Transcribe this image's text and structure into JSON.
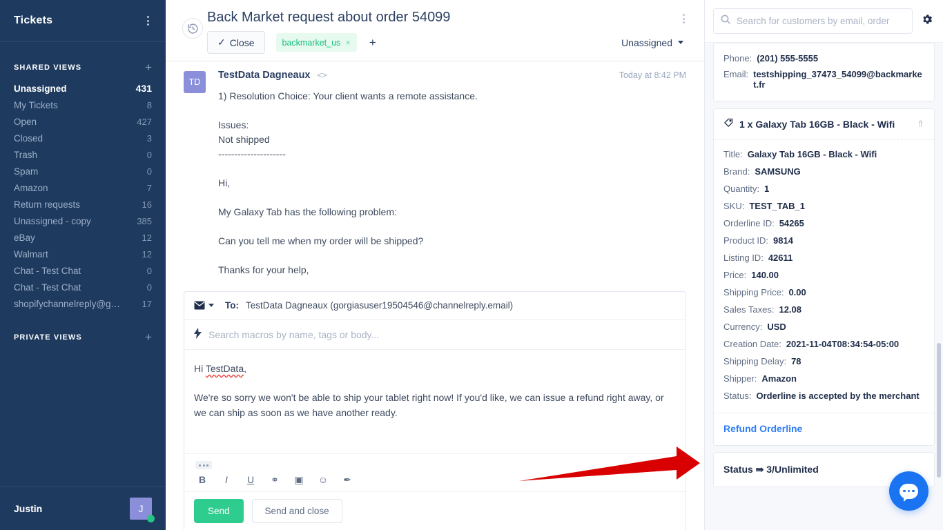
{
  "sidebar": {
    "title": "Tickets",
    "menu_icon": "kebab-menu-icon",
    "shared_views_label": "SHARED VIEWS",
    "private_views_label": "PRIVATE VIEWS",
    "add_label": "+",
    "views": [
      {
        "label": "Unassigned",
        "count": "431",
        "active": true
      },
      {
        "label": "My Tickets",
        "count": "8",
        "active": false
      },
      {
        "label": "Open",
        "count": "427",
        "active": false
      },
      {
        "label": "Closed",
        "count": "3",
        "active": false
      },
      {
        "label": "Trash",
        "count": "0",
        "active": false
      },
      {
        "label": "Spam",
        "count": "0",
        "active": false
      },
      {
        "label": "Amazon",
        "count": "7",
        "active": false
      },
      {
        "label": "Return requests",
        "count": "16",
        "active": false
      },
      {
        "label": "Unassigned - copy",
        "count": "385",
        "active": false
      },
      {
        "label": "eBay",
        "count": "12",
        "active": false
      },
      {
        "label": "Walmart",
        "count": "12",
        "active": false
      },
      {
        "label": "Chat - Test Chat",
        "count": "0",
        "active": false
      },
      {
        "label": "Chat - Test Chat",
        "count": "0",
        "active": false
      },
      {
        "label": "shopifychannelreply@gm...",
        "count": "17",
        "active": false
      }
    ],
    "user_name": "Justin",
    "user_initial": "J"
  },
  "ticket": {
    "title": "Back Market request about order 54099",
    "history_icon": "history-icon",
    "kebab_icon": "kebab-menu-icon",
    "close_label": "Close",
    "close_check": "✓",
    "tag": "backmarket_us",
    "tag_remove": "×",
    "add_tag": "+",
    "assignee": "Unassigned"
  },
  "message": {
    "avatar_initials": "TD",
    "author": "TestData Dagneaux",
    "code_icon": "<>",
    "timestamp": "Today at 8:42 PM",
    "body": "1) Resolution Choice: Your client wants a remote assistance.\n\nIssues:\nNot shipped\n---------------------\n\nHi,\n\nMy Galaxy Tab has the following problem:\n\nCan you tell me when my order will be shipped?\n\nThanks for your help,"
  },
  "composer": {
    "channel_icon": "envelope-icon",
    "to_label": "To:",
    "to_value": "TestData Dagneaux (gorgiasuser19504546@channelreply.email)",
    "macro_icon": "lightning-bolt-icon",
    "macro_placeholder": "Search macros by name, tags or body...",
    "greeting_prefix": "Hi ",
    "greeting_name": "TestData",
    "greeting_suffix": ",",
    "body": "We're so sorry we won't be able to ship your tablet right now! If you'd like, we can issue a refund right away, or we can ship as soon as we have another ready.",
    "tools": [
      {
        "name": "bold-icon",
        "glyph": "B"
      },
      {
        "name": "italic-icon",
        "glyph": "I"
      },
      {
        "name": "underline-icon",
        "glyph": "U"
      },
      {
        "name": "link-icon",
        "glyph": "⚭"
      },
      {
        "name": "image-icon",
        "glyph": "▣"
      },
      {
        "name": "emoji-icon",
        "glyph": "☺"
      },
      {
        "name": "attachment-icon",
        "glyph": "✒"
      }
    ],
    "send_label": "Send",
    "send_alt_label": "Send and close"
  },
  "right_panel": {
    "search_placeholder": "Search for customers by email, order",
    "search_value": "",
    "search_icon": "search-icon",
    "settings_icon": "gear-icon",
    "contact": [
      {
        "key": "Phone:",
        "value": "(201) 555-5555"
      },
      {
        "key": "Email:",
        "value": "testshipping_37473_54099@backmarket.fr"
      }
    ],
    "order": {
      "icon": "tag-icon",
      "title": "1 x Galaxy Tab 16GB - Black - Wifi",
      "collapse_icon": "chevron-up-icon",
      "fields": [
        {
          "key": "Title:",
          "value": "Galaxy Tab 16GB - Black - Wifi"
        },
        {
          "key": "Brand:",
          "value": "SAMSUNG"
        },
        {
          "key": "Quantity:",
          "value": "1"
        },
        {
          "key": "SKU:",
          "value": "TEST_TAB_1"
        },
        {
          "key": "Orderline ID:",
          "value": "54265"
        },
        {
          "key": "Product ID:",
          "value": "9814"
        },
        {
          "key": "Listing ID:",
          "value": "42611"
        },
        {
          "key": "Price:",
          "value": "140.00"
        },
        {
          "key": "Shipping Price:",
          "value": "0.00"
        },
        {
          "key": "Sales Taxes:",
          "value": "12.08"
        },
        {
          "key": "Currency:",
          "value": "USD"
        },
        {
          "key": "Creation Date:",
          "value": "2021-11-04T08:34:54-05:00"
        },
        {
          "key": "Shipping Delay:",
          "value": "78"
        },
        {
          "key": "Shipper:",
          "value": "Amazon"
        },
        {
          "key": "Status:",
          "value": "Orderline is accepted by the merchant"
        }
      ],
      "action_label": "Refund Orderline"
    },
    "status_line": "Status ⇛ 3/Unlimited"
  },
  "chat_widget": {
    "icon": "chat-bubble-icon",
    "color": "#1a73f0"
  },
  "annotation": {
    "type": "red-arrow",
    "color": "#d80000",
    "points_to": "Refund Orderline"
  }
}
